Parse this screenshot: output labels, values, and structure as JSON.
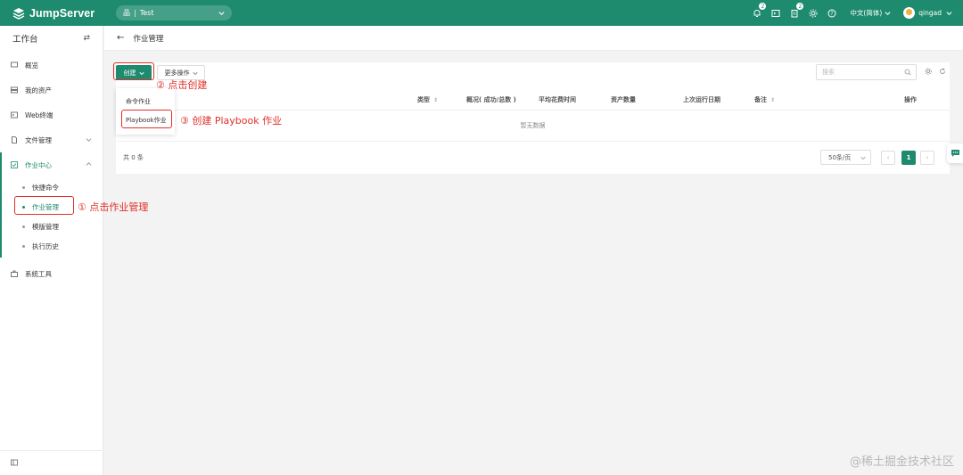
{
  "topbar": {
    "brand": "JumpServer",
    "org_icon": "品",
    "org_name": "Test",
    "notifications": "2",
    "tickets": "2",
    "language": "中文(简体)",
    "username": "qingad"
  },
  "sidebar": {
    "title": "工作台",
    "items": [
      {
        "label": "概览"
      },
      {
        "label": "我的资产"
      },
      {
        "label": "Web终端"
      },
      {
        "label": "文件管理"
      },
      {
        "label": "作业中心"
      },
      {
        "label": "系统工具"
      }
    ],
    "sub_items": [
      {
        "label": "快捷命令"
      },
      {
        "label": "作业管理"
      },
      {
        "label": "模版管理"
      },
      {
        "label": "执行历史"
      }
    ]
  },
  "page": {
    "title": "作业管理",
    "create_label": "创建",
    "more_label": "更多操作",
    "search_placeholder": "搜索",
    "columns": [
      "类型",
      "概况( 成功/总数 )",
      "平均花费时间",
      "资产数量",
      "上次运行日期",
      "备注",
      "操作"
    ],
    "empty_text": "暂无数据",
    "total_text": "共 0 条",
    "page_size": "50条/页",
    "current_page": "1"
  },
  "dropdown": {
    "items": [
      "命令作业",
      "Playbook作业"
    ]
  },
  "annotations": {
    "step1": "① 点击作业管理",
    "step2": "② 点击创建",
    "step3": "③ 创建 Playbook 作业"
  },
  "watermark": "@稀土掘金技术社区",
  "colors": {
    "brand": "#1e8b6e",
    "annotation": "#e0302a"
  }
}
